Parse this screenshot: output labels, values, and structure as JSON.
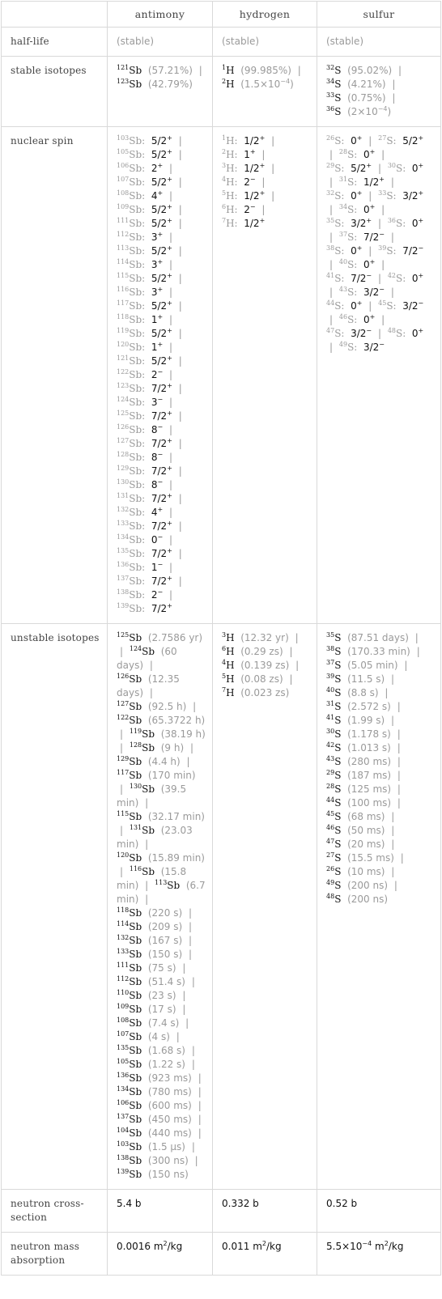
{
  "columns": [
    "",
    "antimony",
    "hydrogen",
    "sulfur"
  ],
  "rows": {
    "half_life": {
      "label": "half-life",
      "values": [
        "(stable)",
        "(stable)",
        "(stable)"
      ]
    },
    "stable_isotopes": {
      "label": "stable isotopes",
      "antimony": [
        {
          "mass": "121",
          "symbol": "Sb",
          "value": "(57.21%)"
        },
        {
          "mass": "123",
          "symbol": "Sb",
          "value": "(42.79%)"
        }
      ],
      "hydrogen": [
        {
          "mass": "1",
          "symbol": "H",
          "value": "(99.985%)"
        },
        {
          "mass": "2",
          "symbol": "H",
          "value": "(1.5×10",
          "exp": "−4",
          "tail": ")"
        }
      ],
      "sulfur": [
        {
          "mass": "32",
          "symbol": "S",
          "value": "(95.02%)"
        },
        {
          "mass": "34",
          "symbol": "S",
          "value": "(4.21%)"
        },
        {
          "mass": "33",
          "symbol": "S",
          "value": "(0.75%)"
        },
        {
          "mass": "36",
          "symbol": "S",
          "value": "(2×10",
          "exp": "−4",
          "tail": ")"
        }
      ]
    },
    "nuclear_spin": {
      "label": "nuclear spin",
      "antimony": [
        {
          "mass": "103",
          "symbol": "Sb",
          "spin": "5/2",
          "parity": "+"
        },
        {
          "mass": "105",
          "symbol": "Sb",
          "spin": "5/2",
          "parity": "+"
        },
        {
          "mass": "106",
          "symbol": "Sb",
          "spin": "2",
          "parity": "+"
        },
        {
          "mass": "107",
          "symbol": "Sb",
          "spin": "5/2",
          "parity": "+"
        },
        {
          "mass": "108",
          "symbol": "Sb",
          "spin": "4",
          "parity": "+"
        },
        {
          "mass": "109",
          "symbol": "Sb",
          "spin": "5/2",
          "parity": "+"
        },
        {
          "mass": "111",
          "symbol": "Sb",
          "spin": "5/2",
          "parity": "+"
        },
        {
          "mass": "112",
          "symbol": "Sb",
          "spin": "3",
          "parity": "+"
        },
        {
          "mass": "113",
          "symbol": "Sb",
          "spin": "5/2",
          "parity": "+"
        },
        {
          "mass": "114",
          "symbol": "Sb",
          "spin": "3",
          "parity": "+"
        },
        {
          "mass": "115",
          "symbol": "Sb",
          "spin": "5/2",
          "parity": "+"
        },
        {
          "mass": "116",
          "symbol": "Sb",
          "spin": "3",
          "parity": "+"
        },
        {
          "mass": "117",
          "symbol": "Sb",
          "spin": "5/2",
          "parity": "+"
        },
        {
          "mass": "118",
          "symbol": "Sb",
          "spin": "1",
          "parity": "+"
        },
        {
          "mass": "119",
          "symbol": "Sb",
          "spin": "5/2",
          "parity": "+"
        },
        {
          "mass": "120",
          "symbol": "Sb",
          "spin": "1",
          "parity": "+"
        },
        {
          "mass": "121",
          "symbol": "Sb",
          "spin": "5/2",
          "parity": "+"
        },
        {
          "mass": "122",
          "symbol": "Sb",
          "spin": "2",
          "parity": "−"
        },
        {
          "mass": "123",
          "symbol": "Sb",
          "spin": "7/2",
          "parity": "+"
        },
        {
          "mass": "124",
          "symbol": "Sb",
          "spin": "3",
          "parity": "−"
        },
        {
          "mass": "125",
          "symbol": "Sb",
          "spin": "7/2",
          "parity": "+"
        },
        {
          "mass": "126",
          "symbol": "Sb",
          "spin": "8",
          "parity": "−"
        },
        {
          "mass": "127",
          "symbol": "Sb",
          "spin": "7/2",
          "parity": "+"
        },
        {
          "mass": "128",
          "symbol": "Sb",
          "spin": "8",
          "parity": "−"
        },
        {
          "mass": "129",
          "symbol": "Sb",
          "spin": "7/2",
          "parity": "+"
        },
        {
          "mass": "130",
          "symbol": "Sb",
          "spin": "8",
          "parity": "−"
        },
        {
          "mass": "131",
          "symbol": "Sb",
          "spin": "7/2",
          "parity": "+"
        },
        {
          "mass": "132",
          "symbol": "Sb",
          "spin": "4",
          "parity": "+"
        },
        {
          "mass": "133",
          "symbol": "Sb",
          "spin": "7/2",
          "parity": "+"
        },
        {
          "mass": "134",
          "symbol": "Sb",
          "spin": "0",
          "parity": "−"
        },
        {
          "mass": "135",
          "symbol": "Sb",
          "spin": "7/2",
          "parity": "+"
        },
        {
          "mass": "136",
          "symbol": "Sb",
          "spin": "1",
          "parity": "−"
        },
        {
          "mass": "137",
          "symbol": "Sb",
          "spin": "7/2",
          "parity": "+"
        },
        {
          "mass": "138",
          "symbol": "Sb",
          "spin": "2",
          "parity": "−"
        },
        {
          "mass": "139",
          "symbol": "Sb",
          "spin": "7/2",
          "parity": "+"
        }
      ],
      "hydrogen": [
        {
          "mass": "1",
          "symbol": "H",
          "spin": "1/2",
          "parity": "+"
        },
        {
          "mass": "2",
          "symbol": "H",
          "spin": "1",
          "parity": "+"
        },
        {
          "mass": "3",
          "symbol": "H",
          "spin": "1/2",
          "parity": "+"
        },
        {
          "mass": "4",
          "symbol": "H",
          "spin": "2",
          "parity": "−"
        },
        {
          "mass": "5",
          "symbol": "H",
          "spin": "1/2",
          "parity": "+"
        },
        {
          "mass": "6",
          "symbol": "H",
          "spin": "2",
          "parity": "−"
        },
        {
          "mass": "7",
          "symbol": "H",
          "spin": "1/2",
          "parity": "+"
        }
      ],
      "sulfur": [
        {
          "mass": "26",
          "symbol": "S",
          "spin": "0",
          "parity": "+"
        },
        {
          "mass": "27",
          "symbol": "S",
          "spin": "5/2",
          "parity": "+"
        },
        {
          "mass": "28",
          "symbol": "S",
          "spin": "0",
          "parity": "+"
        },
        {
          "mass": "29",
          "symbol": "S",
          "spin": "5/2",
          "parity": "+"
        },
        {
          "mass": "30",
          "symbol": "S",
          "spin": "0",
          "parity": "+"
        },
        {
          "mass": "31",
          "symbol": "S",
          "spin": "1/2",
          "parity": "+"
        },
        {
          "mass": "32",
          "symbol": "S",
          "spin": "0",
          "parity": "+"
        },
        {
          "mass": "33",
          "symbol": "S",
          "spin": "3/2",
          "parity": "+"
        },
        {
          "mass": "34",
          "symbol": "S",
          "spin": "0",
          "parity": "+"
        },
        {
          "mass": "35",
          "symbol": "S",
          "spin": "3/2",
          "parity": "+"
        },
        {
          "mass": "36",
          "symbol": "S",
          "spin": "0",
          "parity": "+"
        },
        {
          "mass": "37",
          "symbol": "S",
          "spin": "7/2",
          "parity": "−"
        },
        {
          "mass": "38",
          "symbol": "S",
          "spin": "0",
          "parity": "+"
        },
        {
          "mass": "39",
          "symbol": "S",
          "spin": "7/2",
          "parity": "−"
        },
        {
          "mass": "40",
          "symbol": "S",
          "spin": "0",
          "parity": "+"
        },
        {
          "mass": "41",
          "symbol": "S",
          "spin": "7/2",
          "parity": "−"
        },
        {
          "mass": "42",
          "symbol": "S",
          "spin": "0",
          "parity": "+"
        },
        {
          "mass": "43",
          "symbol": "S",
          "spin": "3/2",
          "parity": "−"
        },
        {
          "mass": "44",
          "symbol": "S",
          "spin": "0",
          "parity": "+"
        },
        {
          "mass": "45",
          "symbol": "S",
          "spin": "3/2",
          "parity": "−"
        },
        {
          "mass": "46",
          "symbol": "S",
          "spin": "0",
          "parity": "+"
        },
        {
          "mass": "47",
          "symbol": "S",
          "spin": "3/2",
          "parity": "−"
        },
        {
          "mass": "48",
          "symbol": "S",
          "spin": "0",
          "parity": "+"
        },
        {
          "mass": "49",
          "symbol": "S",
          "spin": "3/2",
          "parity": "−"
        }
      ]
    },
    "unstable_isotopes": {
      "label": "unstable isotopes",
      "antimony": [
        {
          "mass": "125",
          "symbol": "Sb",
          "value": "(2.7586 yr)"
        },
        {
          "mass": "124",
          "symbol": "Sb",
          "value": "(60 days)"
        },
        {
          "mass": "126",
          "symbol": "Sb",
          "value": "(12.35 days)"
        },
        {
          "mass": "127",
          "symbol": "Sb",
          "value": "(92.5 h)"
        },
        {
          "mass": "122",
          "symbol": "Sb",
          "value": "(65.3722 h)"
        },
        {
          "mass": "119",
          "symbol": "Sb",
          "value": "(38.19 h)"
        },
        {
          "mass": "128",
          "symbol": "Sb",
          "value": "(9 h)"
        },
        {
          "mass": "129",
          "symbol": "Sb",
          "value": "(4.4 h)"
        },
        {
          "mass": "117",
          "symbol": "Sb",
          "value": "(170 min)"
        },
        {
          "mass": "130",
          "symbol": "Sb",
          "value": "(39.5 min)"
        },
        {
          "mass": "115",
          "symbol": "Sb",
          "value": "(32.17 min)"
        },
        {
          "mass": "131",
          "symbol": "Sb",
          "value": "(23.03 min)"
        },
        {
          "mass": "120",
          "symbol": "Sb",
          "value": "(15.89 min)"
        },
        {
          "mass": "116",
          "symbol": "Sb",
          "value": "(15.8 min)"
        },
        {
          "mass": "113",
          "symbol": "Sb",
          "value": "(6.7 min)"
        },
        {
          "mass": "118",
          "symbol": "Sb",
          "value": "(220 s)"
        },
        {
          "mass": "114",
          "symbol": "Sb",
          "value": "(209 s)"
        },
        {
          "mass": "132",
          "symbol": "Sb",
          "value": "(167 s)"
        },
        {
          "mass": "133",
          "symbol": "Sb",
          "value": "(150 s)"
        },
        {
          "mass": "111",
          "symbol": "Sb",
          "value": "(75 s)"
        },
        {
          "mass": "112",
          "symbol": "Sb",
          "value": "(51.4 s)"
        },
        {
          "mass": "110",
          "symbol": "Sb",
          "value": "(23 s)"
        },
        {
          "mass": "109",
          "symbol": "Sb",
          "value": "(17 s)"
        },
        {
          "mass": "108",
          "symbol": "Sb",
          "value": "(7.4 s)"
        },
        {
          "mass": "107",
          "symbol": "Sb",
          "value": "(4 s)"
        },
        {
          "mass": "135",
          "symbol": "Sb",
          "value": "(1.68 s)"
        },
        {
          "mass": "105",
          "symbol": "Sb",
          "value": "(1.22 s)"
        },
        {
          "mass": "136",
          "symbol": "Sb",
          "value": "(923 ms)"
        },
        {
          "mass": "134",
          "symbol": "Sb",
          "value": "(780 ms)"
        },
        {
          "mass": "106",
          "symbol": "Sb",
          "value": "(600 ms)"
        },
        {
          "mass": "137",
          "symbol": "Sb",
          "value": "(450 ms)"
        },
        {
          "mass": "104",
          "symbol": "Sb",
          "value": "(440 ms)"
        },
        {
          "mass": "103",
          "symbol": "Sb",
          "value": "(1.5 µs)"
        },
        {
          "mass": "138",
          "symbol": "Sb",
          "value": "(300 ns)"
        },
        {
          "mass": "139",
          "symbol": "Sb",
          "value": "(150 ns)"
        }
      ],
      "hydrogen": [
        {
          "mass": "3",
          "symbol": "H",
          "value": "(12.32 yr)"
        },
        {
          "mass": "6",
          "symbol": "H",
          "value": "(0.29 zs)"
        },
        {
          "mass": "4",
          "symbol": "H",
          "value": "(0.139 zs)"
        },
        {
          "mass": "5",
          "symbol": "H",
          "value": "(0.08 zs)"
        },
        {
          "mass": "7",
          "symbol": "H",
          "value": "(0.023 zs)"
        }
      ],
      "sulfur": [
        {
          "mass": "35",
          "symbol": "S",
          "value": "(87.51 days)"
        },
        {
          "mass": "38",
          "symbol": "S",
          "value": "(170.33 min)"
        },
        {
          "mass": "37",
          "symbol": "S",
          "value": "(5.05 min)"
        },
        {
          "mass": "39",
          "symbol": "S",
          "value": "(11.5 s)"
        },
        {
          "mass": "40",
          "symbol": "S",
          "value": "(8.8 s)"
        },
        {
          "mass": "31",
          "symbol": "S",
          "value": "(2.572 s)"
        },
        {
          "mass": "41",
          "symbol": "S",
          "value": "(1.99 s)"
        },
        {
          "mass": "30",
          "symbol": "S",
          "value": "(1.178 s)"
        },
        {
          "mass": "42",
          "symbol": "S",
          "value": "(1.013 s)"
        },
        {
          "mass": "43",
          "symbol": "S",
          "value": "(280 ms)"
        },
        {
          "mass": "29",
          "symbol": "S",
          "value": "(187 ms)"
        },
        {
          "mass": "28",
          "symbol": "S",
          "value": "(125 ms)"
        },
        {
          "mass": "44",
          "symbol": "S",
          "value": "(100 ms)"
        },
        {
          "mass": "45",
          "symbol": "S",
          "value": "(68 ms)"
        },
        {
          "mass": "46",
          "symbol": "S",
          "value": "(50 ms)"
        },
        {
          "mass": "47",
          "symbol": "S",
          "value": "(20 ms)"
        },
        {
          "mass": "27",
          "symbol": "S",
          "value": "(15.5 ms)"
        },
        {
          "mass": "26",
          "symbol": "S",
          "value": "(10 ms)"
        },
        {
          "mass": "49",
          "symbol": "S",
          "value": "(200 ns)"
        },
        {
          "mass": "48",
          "symbol": "S",
          "value": "(200 ns)"
        }
      ]
    },
    "neutron_cross_section": {
      "label": "neutron cross-section",
      "values": [
        "5.4 b",
        "0.332 b",
        "0.52 b"
      ]
    },
    "neutron_mass_absorption": {
      "label": "neutron mass absorption",
      "values": [
        {
          "mantissa": "0.0016",
          "unit": "m",
          "unit_exp": "2",
          "unit_tail": "/kg"
        },
        {
          "mantissa": "0.011",
          "unit": "m",
          "unit_exp": "2",
          "unit_tail": "/kg"
        },
        {
          "mantissa": "5.5×10",
          "exp": "−4",
          "unit": "m",
          "unit_exp": "2",
          "unit_tail": "/kg"
        }
      ]
    }
  },
  "colors": {
    "border": "#d9d9d9",
    "label_text": "#444444",
    "value_text": "#111111",
    "muted_text": "#9a9a9a"
  }
}
